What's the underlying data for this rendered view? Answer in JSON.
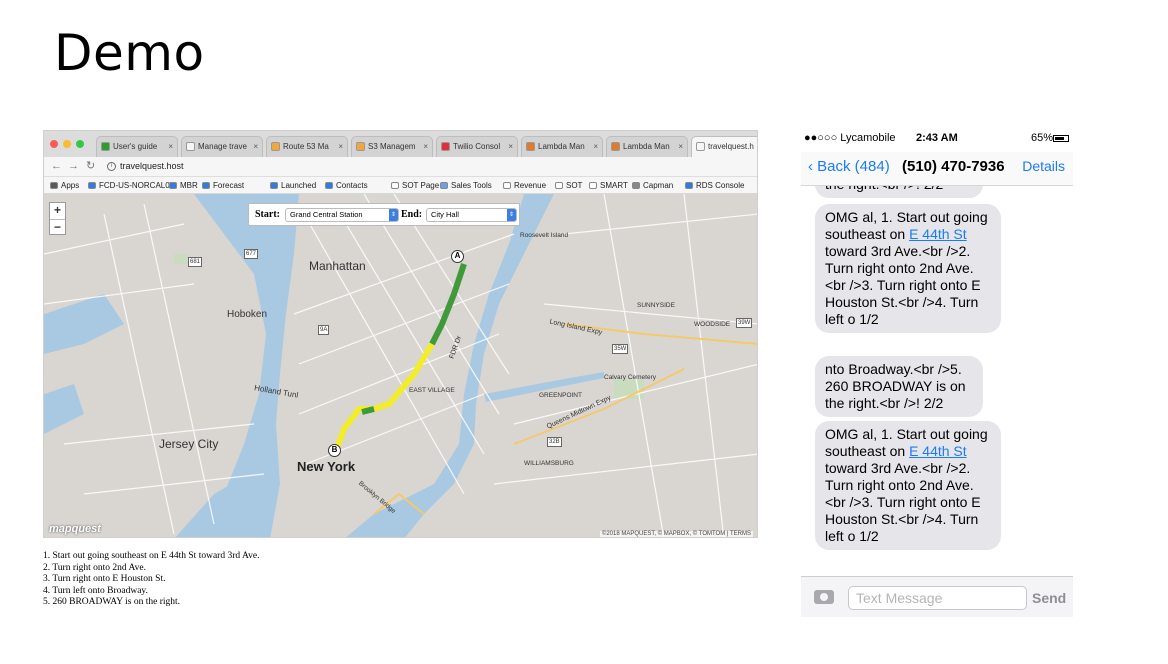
{
  "slide": {
    "title": "Demo"
  },
  "browser": {
    "tabs": [
      {
        "label": "User's guide",
        "color": "#2e9e2a"
      },
      {
        "label": "Manage trave",
        "color": "#f6f6f6"
      },
      {
        "label": "Route 53 Ma",
        "color": "#f0a83c"
      },
      {
        "label": "S3 Managem",
        "color": "#f0a83c"
      },
      {
        "label": "Twilio Consol",
        "color": "#e0303f"
      },
      {
        "label": "Lambda Man",
        "color": "#e07a2c"
      },
      {
        "label": "Lambda Man",
        "color": "#e07a2c"
      },
      {
        "label": "travelquest.h",
        "color": "#f6f6f6"
      }
    ],
    "url": "travelquest.host",
    "bookmarks": [
      "Apps",
      "FCD-US-NORCAL05",
      "MBR",
      "Forecast",
      "Launched",
      "Contacts",
      "SOT Page 2",
      "Sales Tools",
      "Revenue",
      "SOT",
      "SMART",
      "Capman",
      "RDS Console"
    ]
  },
  "map": {
    "start_label": "Start:",
    "start_value": "Grand Central Station",
    "end_label": "End:",
    "end_value": "City Hall",
    "zoom_in": "+",
    "zoom_out": "−",
    "pin_a": "A",
    "pin_b": "B",
    "logo": "mapquest",
    "attribution": "©2018 MAPQUEST, © MAPBOX, © TOMTOM | TERMS",
    "labels": {
      "manhattan": "Manhattan",
      "hoboken": "Hoboken",
      "jersey_city": "Jersey City",
      "new_york": "New York",
      "holland_tunl": "Holland Tunl",
      "long_island_expy": "Long Island Expy",
      "queens_midtown": "Queens Midtown Expy",
      "fdr_dr": "FDR Dr",
      "greenpoint": "GREENPOINT",
      "williamsburg": "WILLIAMSBURG",
      "east_village": "EAST VILLAGE",
      "calvary": "Calvary Cemetery",
      "sunnyside": "SUNNYSIDE",
      "woodside": "WOODSIDE",
      "roosevelt": "Roosevelt Island",
      "brooklyn_bridge": "Brooklyn Bridge"
    },
    "route_colors": {
      "fast": "#3f9a3a",
      "slow": "#f2ec2a"
    }
  },
  "directions": [
    "1. Start out going southeast on E 44th St toward 3rd Ave.",
    "2. Turn right onto 2nd Ave.",
    "3. Turn right onto E Houston St.",
    "4. Turn left onto Broadway.",
    "5. 260 BROADWAY is on the right."
  ],
  "phone": {
    "carrier": "●●○○○ Lycamobile",
    "time": "2:43 AM",
    "battery": "65%",
    "back": "Back (484)",
    "contact": "(510) 470-7936",
    "details": "Details",
    "messages": [
      {
        "pre": "the right.<br />! 2/2",
        "link": "",
        "post": ""
      },
      {
        "pre": "OMG al, 1. Start out going southeast on ",
        "link": "E 44th St",
        "post": " toward 3rd Ave.<br />2. Turn right onto 2nd Ave.<br />3. Turn right onto E Houston St.<br />4. Turn left o 1/2"
      },
      {
        "pre": "nto Broadway.<br />5. 260 BROADWAY is on the right.<br />! 2/2",
        "link": "",
        "post": ""
      },
      {
        "pre": "OMG al, 1. Start out going southeast on ",
        "link": "E 44th St",
        "post": " toward 3rd Ave.<br />2. Turn right onto 2nd Ave.<br />3. Turn right onto E Houston St.<br />4. Turn left o 1/2"
      }
    ],
    "placeholder": "Text Message",
    "send": "Send"
  }
}
